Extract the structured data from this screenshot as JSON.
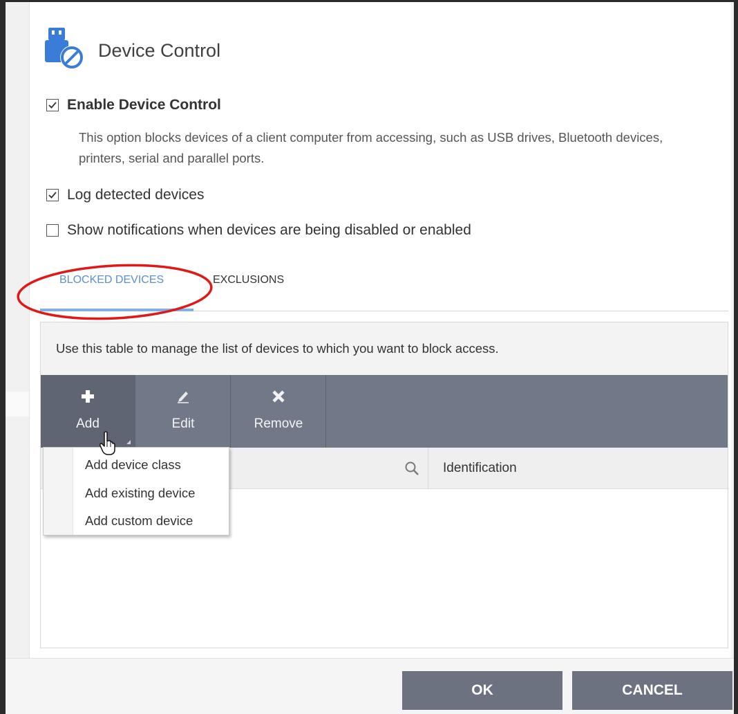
{
  "header": {
    "title": "Device Control",
    "icon": "usb-blocked-icon"
  },
  "options": {
    "enable_label": "Enable Device Control",
    "enable_checked": true,
    "enable_description": "This option blocks devices of a client computer from accessing, such as USB drives, Bluetooth devices, printers, serial and parallel ports.",
    "log_label": "Log detected devices",
    "log_checked": true,
    "notify_label": "Show notifications when devices are being disabled or enabled",
    "notify_checked": false
  },
  "tabs": [
    {
      "label": "BLOCKED DEVICES",
      "active": true
    },
    {
      "label": "EXCLUSIONS",
      "active": false
    }
  ],
  "panel": {
    "description": "Use this table to manage the list of devices to which you want to block access."
  },
  "toolbar": {
    "add_label": "Add",
    "edit_label": "Edit",
    "remove_label": "Remove"
  },
  "table": {
    "columns": [
      "",
      "Identification"
    ]
  },
  "add_menu": {
    "items": [
      "Add device class",
      "Add existing device",
      "Add custom device"
    ]
  },
  "footer": {
    "ok_label": "OK",
    "cancel_label": "CANCEL"
  },
  "colors": {
    "accent_tab": "#5a8fd0",
    "toolbar": "#717887",
    "button": "#6d7281",
    "annotation": "#e01818"
  }
}
